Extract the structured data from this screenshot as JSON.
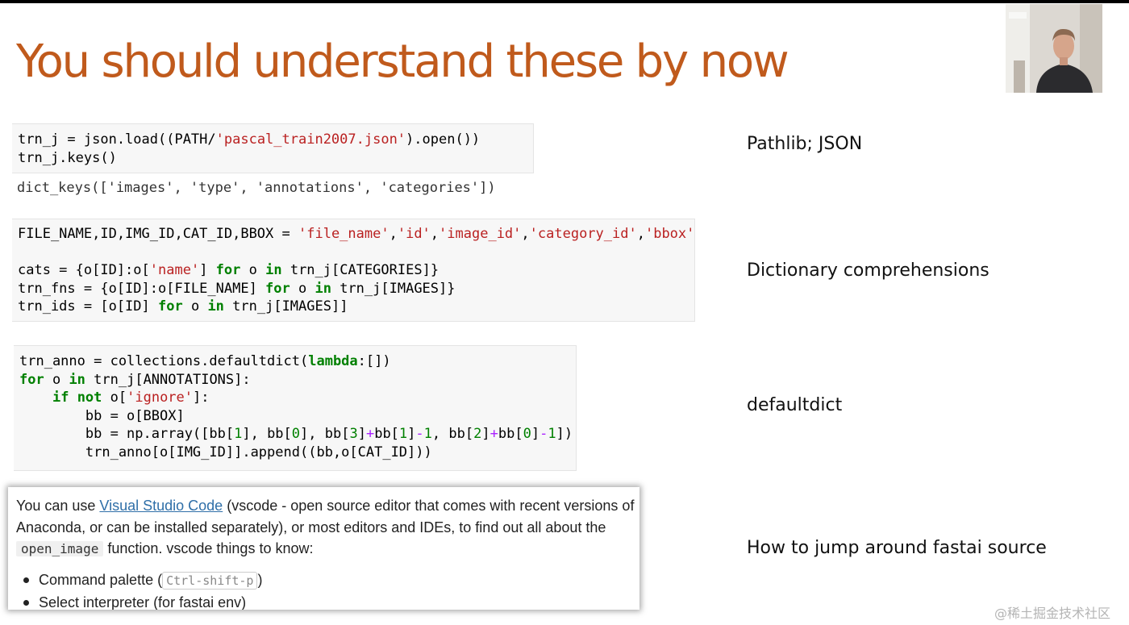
{
  "slide": {
    "title": "You should understand these by now"
  },
  "cell_1": {
    "lines": [
      [
        {
          "t": "trn_j = json.load((PATH/",
          "c": ""
        },
        {
          "t": "'pascal_train2007.json'",
          "c": "str"
        },
        {
          "t": ").open())",
          "c": ""
        }
      ],
      [
        {
          "t": "trn_j.keys()",
          "c": ""
        }
      ]
    ],
    "output": "dict_keys(['images', 'type', 'annotations', 'categories'])"
  },
  "cell_2": {
    "lines": [
      [
        {
          "t": "FILE_NAME,ID,IMG_ID,CAT_ID,BBOX = ",
          "c": ""
        },
        {
          "t": "'file_name'",
          "c": "str"
        },
        {
          "t": ",",
          "c": ""
        },
        {
          "t": "'id'",
          "c": "str"
        },
        {
          "t": ",",
          "c": ""
        },
        {
          "t": "'image_id'",
          "c": "str"
        },
        {
          "t": ",",
          "c": ""
        },
        {
          "t": "'category_id'",
          "c": "str"
        },
        {
          "t": ",",
          "c": ""
        },
        {
          "t": "'bbox'",
          "c": "str"
        }
      ],
      [],
      [
        {
          "t": "cats = {o[ID]:o[",
          "c": ""
        },
        {
          "t": "'name'",
          "c": "str"
        },
        {
          "t": "] ",
          "c": ""
        },
        {
          "t": "for",
          "c": "kw"
        },
        {
          "t": " o ",
          "c": ""
        },
        {
          "t": "in",
          "c": "kw"
        },
        {
          "t": " trn_j[CATEGORIES]}",
          "c": ""
        }
      ],
      [
        {
          "t": "trn_fns = {o[ID]:o[FILE_NAME] ",
          "c": ""
        },
        {
          "t": "for",
          "c": "kw"
        },
        {
          "t": " o ",
          "c": ""
        },
        {
          "t": "in",
          "c": "kw"
        },
        {
          "t": " trn_j[IMAGES]}",
          "c": ""
        }
      ],
      [
        {
          "t": "trn_ids = [o[ID] ",
          "c": ""
        },
        {
          "t": "for",
          "c": "kw"
        },
        {
          "t": " o ",
          "c": ""
        },
        {
          "t": "in",
          "c": "kw"
        },
        {
          "t": " trn_j[IMAGES]]",
          "c": ""
        }
      ]
    ]
  },
  "cell_3": {
    "lines": [
      [
        {
          "t": "trn_anno = collections.defaultdict(",
          "c": ""
        },
        {
          "t": "lambda",
          "c": "kw"
        },
        {
          "t": ":[])",
          "c": ""
        }
      ],
      [
        {
          "t": "for",
          "c": "kw"
        },
        {
          "t": " o ",
          "c": ""
        },
        {
          "t": "in",
          "c": "kw"
        },
        {
          "t": " trn_j[ANNOTATIONS]:",
          "c": ""
        }
      ],
      [
        {
          "t": "    ",
          "c": ""
        },
        {
          "t": "if",
          "c": "kw"
        },
        {
          "t": " ",
          "c": ""
        },
        {
          "t": "not",
          "c": "kw"
        },
        {
          "t": " o[",
          "c": ""
        },
        {
          "t": "'ignore'",
          "c": "str"
        },
        {
          "t": "]:",
          "c": ""
        }
      ],
      [
        {
          "t": "        bb = o[BBOX]",
          "c": ""
        }
      ],
      [
        {
          "t": "        bb = np.array([bb[",
          "c": ""
        },
        {
          "t": "1",
          "c": "num"
        },
        {
          "t": "], bb[",
          "c": ""
        },
        {
          "t": "0",
          "c": "num"
        },
        {
          "t": "], bb[",
          "c": ""
        },
        {
          "t": "3",
          "c": "num"
        },
        {
          "t": "]",
          "c": ""
        },
        {
          "t": "+",
          "c": "op"
        },
        {
          "t": "bb[",
          "c": ""
        },
        {
          "t": "1",
          "c": "num"
        },
        {
          "t": "]",
          "c": ""
        },
        {
          "t": "-",
          "c": "op"
        },
        {
          "t": "1",
          "c": "num"
        },
        {
          "t": ", bb[",
          "c": ""
        },
        {
          "t": "2",
          "c": "num"
        },
        {
          "t": "]",
          "c": ""
        },
        {
          "t": "+",
          "c": "op"
        },
        {
          "t": "bb[",
          "c": ""
        },
        {
          "t": "0",
          "c": "num"
        },
        {
          "t": "]",
          "c": ""
        },
        {
          "t": "-",
          "c": "op"
        },
        {
          "t": "1",
          "c": "num"
        },
        {
          "t": "])",
          "c": ""
        }
      ],
      [
        {
          "t": "        trn_anno[o[IMG_ID]].append((bb,o[CAT_ID]))",
          "c": ""
        }
      ]
    ]
  },
  "labels": {
    "pathlib": "Pathlib; JSON",
    "dict_comp": "Dictionary comprehensions",
    "defaultdict": "defaultdict",
    "jump_source": "How to jump around fastai source"
  },
  "doc": {
    "p_before_link": "You can use ",
    "link_text": "Visual Studio Code",
    "p_after_link": " (vscode - open source editor that comes with recent versions of Anaconda, or can be installed separately), or most editors and IDEs, to find out all about the ",
    "inline_code": "open_image",
    "p_end": " function. vscode things to know:",
    "bullet_1_before": "Command palette (",
    "bullet_1_kbd": "Ctrl-shift-p",
    "bullet_1_after": ")",
    "bullet_2": "Select interpreter (for fastai env)"
  },
  "watermark": "@稀土掘金技术社区"
}
